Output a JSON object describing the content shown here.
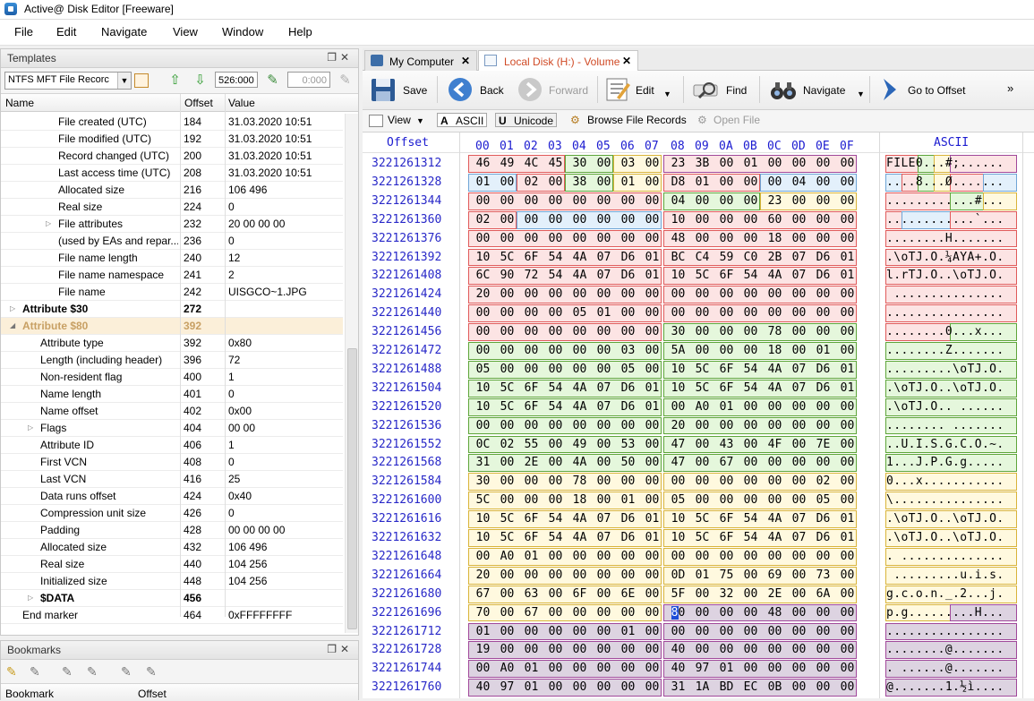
{
  "window": {
    "title": "Active@ Disk Editor [Freeware]"
  },
  "menu": [
    "File",
    "Edit",
    "Navigate",
    "View",
    "Window",
    "Help"
  ],
  "templates_panel": {
    "title": "Templates",
    "template_select": "NTFS MFT File Recorc",
    "offset_value": "526:000",
    "secondary_value": "0:000",
    "columns": {
      "name": "Name",
      "offset": "Offset",
      "value": "Value"
    },
    "rows": [
      {
        "name": "File created (UTC)",
        "offset": "184",
        "value": "31.03.2020 10:51",
        "indent": 3
      },
      {
        "name": "File modified (UTC)",
        "offset": "192",
        "value": "31.03.2020 10:51",
        "indent": 3
      },
      {
        "name": "Record changed (UTC)",
        "offset": "200",
        "value": "31.03.2020 10:51",
        "indent": 3
      },
      {
        "name": "Last access time (UTC)",
        "offset": "208",
        "value": "31.03.2020 10:51",
        "indent": 3
      },
      {
        "name": "Allocated size",
        "offset": "216",
        "value": "106 496",
        "indent": 3
      },
      {
        "name": "Real size",
        "offset": "224",
        "value": "0",
        "indent": 3
      },
      {
        "name": "File attributes",
        "offset": "232",
        "value": "20 00 00 00",
        "indent": 3,
        "expander": "collapsed"
      },
      {
        "name": "(used by EAs and repar...",
        "offset": "236",
        "value": "0",
        "indent": 3
      },
      {
        "name": "File name length",
        "offset": "240",
        "value": "12",
        "indent": 3
      },
      {
        "name": "File name namespace",
        "offset": "241",
        "value": "2",
        "indent": 3
      },
      {
        "name": "File name",
        "offset": "242",
        "value": "UISGCO~1.JPG",
        "indent": 3
      },
      {
        "name": "Attribute $30",
        "offset": "272",
        "value": "",
        "indent": 1,
        "bold": true,
        "expander": "collapsed"
      },
      {
        "name": "Attribute $80",
        "offset": "392",
        "value": "",
        "indent": 1,
        "bold": true,
        "selected": true,
        "expander": "expanded"
      },
      {
        "name": "Attribute type",
        "offset": "392",
        "value": "0x80",
        "indent": 2
      },
      {
        "name": "Length (including header)",
        "offset": "396",
        "value": "72",
        "indent": 2
      },
      {
        "name": "Non-resident flag",
        "offset": "400",
        "value": "1",
        "indent": 2
      },
      {
        "name": "Name length",
        "offset": "401",
        "value": "0",
        "indent": 2
      },
      {
        "name": "Name offset",
        "offset": "402",
        "value": "0x00",
        "indent": 2
      },
      {
        "name": "Flags",
        "offset": "404",
        "value": "00 00",
        "indent": 2,
        "expander": "collapsed"
      },
      {
        "name": "Attribute ID",
        "offset": "406",
        "value": "1",
        "indent": 2
      },
      {
        "name": "First VCN",
        "offset": "408",
        "value": "0",
        "indent": 2
      },
      {
        "name": "Last VCN",
        "offset": "416",
        "value": "25",
        "indent": 2
      },
      {
        "name": "Data runs offset",
        "offset": "424",
        "value": "0x40",
        "indent": 2
      },
      {
        "name": "Compression unit size",
        "offset": "426",
        "value": "0",
        "indent": 2
      },
      {
        "name": "Padding",
        "offset": "428",
        "value": "00 00 00 00",
        "indent": 2
      },
      {
        "name": "Allocated size",
        "offset": "432",
        "value": "106 496",
        "indent": 2
      },
      {
        "name": "Real size",
        "offset": "440",
        "value": "104 256",
        "indent": 2
      },
      {
        "name": "Initialized size",
        "offset": "448",
        "value": "104 256",
        "indent": 2
      },
      {
        "name": "$DATA",
        "offset": "456",
        "value": "",
        "indent": 2,
        "bold": true,
        "expander": "collapsed"
      },
      {
        "name": "End marker",
        "offset": "464",
        "value": "0xFFFFFFFF",
        "indent": 1
      }
    ]
  },
  "bookmarks_panel": {
    "title": "Bookmarks",
    "columns": {
      "bookmark": "Bookmark",
      "offset": "Offset"
    }
  },
  "tabs": [
    {
      "label": "My Computer",
      "active": false
    },
    {
      "label": "Local Disk (H:) - Volume",
      "active": true
    }
  ],
  "toolbar": {
    "save": "Save",
    "back": "Back",
    "forward": "Forward",
    "edit": "Edit",
    "find": "Find",
    "navigate": "Navigate",
    "goto": "Go to Offset",
    "more": "»"
  },
  "subtoolbar": {
    "view": "View",
    "ascii": "ASCII",
    "unicode": "Unicode",
    "browse": "Browse File Records",
    "open_file": "Open File"
  },
  "hex": {
    "offset_header": "Offset",
    "ascii_header": "ASCII",
    "byte_headers": [
      "00",
      "01",
      "02",
      "03",
      "04",
      "05",
      "06",
      "07",
      "08",
      "09",
      "0A",
      "0B",
      "0C",
      "0D",
      "0E",
      "0F"
    ],
    "cursor_digit": "8",
    "cursor_rest": "0",
    "rows": [
      {
        "offset": "3221261312",
        "bytes": [
          "46",
          "49",
          "4C",
          "45",
          "30",
          "00",
          "03",
          "00",
          "23",
          "3B",
          "00",
          "01",
          "00",
          "00",
          "00",
          "00"
        ],
        "ascii": "FILE0...#;......"
      },
      {
        "offset": "3221261328",
        "bytes": [
          "01",
          "00",
          "02",
          "00",
          "38",
          "00",
          "01",
          "00",
          "D8",
          "01",
          "00",
          "00",
          "00",
          "04",
          "00",
          "00"
        ],
        "ascii": "....8...Ø......."
      },
      {
        "offset": "3221261344",
        "bytes": [
          "00",
          "00",
          "00",
          "00",
          "00",
          "00",
          "00",
          "00",
          "04",
          "00",
          "00",
          "00",
          "23",
          "00",
          "00",
          "00"
        ],
        "ascii": "............#..."
      },
      {
        "offset": "3221261360",
        "bytes": [
          "02",
          "00",
          "00",
          "00",
          "00",
          "00",
          "00",
          "00",
          "10",
          "00",
          "00",
          "00",
          "60",
          "00",
          "00",
          "00"
        ],
        "ascii": "............`..."
      },
      {
        "offset": "3221261376",
        "bytes": [
          "00",
          "00",
          "00",
          "00",
          "00",
          "00",
          "00",
          "00",
          "48",
          "00",
          "00",
          "00",
          "18",
          "00",
          "00",
          "00"
        ],
        "ascii": "........H......."
      },
      {
        "offset": "3221261392",
        "bytes": [
          "10",
          "5C",
          "6F",
          "54",
          "4A",
          "07",
          "D6",
          "01",
          "BC",
          "C4",
          "59",
          "C0",
          "2B",
          "07",
          "D6",
          "01"
        ],
        "ascii": ".\\oTJ.Ö.¼ÄYÀ+.Ö."
      },
      {
        "offset": "3221261408",
        "bytes": [
          "6C",
          "90",
          "72",
          "54",
          "4A",
          "07",
          "D6",
          "01",
          "10",
          "5C",
          "6F",
          "54",
          "4A",
          "07",
          "D6",
          "01"
        ],
        "ascii": "l.rTJ.Ö..\\oTJ.Ö."
      },
      {
        "offset": "3221261424",
        "bytes": [
          "20",
          "00",
          "00",
          "00",
          "00",
          "00",
          "00",
          "00",
          "00",
          "00",
          "00",
          "00",
          "00",
          "00",
          "00",
          "00"
        ],
        "ascii": " ..............."
      },
      {
        "offset": "3221261440",
        "bytes": [
          "00",
          "00",
          "00",
          "00",
          "05",
          "01",
          "00",
          "00",
          "00",
          "00",
          "00",
          "00",
          "00",
          "00",
          "00",
          "00"
        ],
        "ascii": "................"
      },
      {
        "offset": "3221261456",
        "bytes": [
          "00",
          "00",
          "00",
          "00",
          "00",
          "00",
          "00",
          "00",
          "30",
          "00",
          "00",
          "00",
          "78",
          "00",
          "00",
          "00"
        ],
        "ascii": "........0...x..."
      },
      {
        "offset": "3221261472",
        "bytes": [
          "00",
          "00",
          "00",
          "00",
          "00",
          "00",
          "03",
          "00",
          "5A",
          "00",
          "00",
          "00",
          "18",
          "00",
          "01",
          "00"
        ],
        "ascii": "........Z......."
      },
      {
        "offset": "3221261488",
        "bytes": [
          "05",
          "00",
          "00",
          "00",
          "00",
          "00",
          "05",
          "00",
          "10",
          "5C",
          "6F",
          "54",
          "4A",
          "07",
          "D6",
          "01"
        ],
        "ascii": ".........\\oTJ.Ö."
      },
      {
        "offset": "3221261504",
        "bytes": [
          "10",
          "5C",
          "6F",
          "54",
          "4A",
          "07",
          "D6",
          "01",
          "10",
          "5C",
          "6F",
          "54",
          "4A",
          "07",
          "D6",
          "01"
        ],
        "ascii": ".\\oTJ.Ö..\\oTJ.Ö."
      },
      {
        "offset": "3221261520",
        "bytes": [
          "10",
          "5C",
          "6F",
          "54",
          "4A",
          "07",
          "D6",
          "01",
          "00",
          "A0",
          "01",
          "00",
          "00",
          "00",
          "00",
          "00"
        ],
        "ascii": ".\\oTJ.Ö.. ......"
      },
      {
        "offset": "3221261536",
        "bytes": [
          "00",
          "00",
          "00",
          "00",
          "00",
          "00",
          "00",
          "00",
          "20",
          "00",
          "00",
          "00",
          "00",
          "00",
          "00",
          "00"
        ],
        "ascii": "........ ......."
      },
      {
        "offset": "3221261552",
        "bytes": [
          "0C",
          "02",
          "55",
          "00",
          "49",
          "00",
          "53",
          "00",
          "47",
          "00",
          "43",
          "00",
          "4F",
          "00",
          "7E",
          "00"
        ],
        "ascii": "..U.I.S.G.C.O.~."
      },
      {
        "offset": "3221261568",
        "bytes": [
          "31",
          "00",
          "2E",
          "00",
          "4A",
          "00",
          "50",
          "00",
          "47",
          "00",
          "67",
          "00",
          "00",
          "00",
          "00",
          "00"
        ],
        "ascii": "1...J.P.G.g....."
      },
      {
        "offset": "3221261584",
        "bytes": [
          "30",
          "00",
          "00",
          "00",
          "78",
          "00",
          "00",
          "00",
          "00",
          "00",
          "00",
          "00",
          "00",
          "00",
          "02",
          "00"
        ],
        "ascii": "0...x..........."
      },
      {
        "offset": "3221261600",
        "bytes": [
          "5C",
          "00",
          "00",
          "00",
          "18",
          "00",
          "01",
          "00",
          "05",
          "00",
          "00",
          "00",
          "00",
          "00",
          "05",
          "00"
        ],
        "ascii": "\\..............."
      },
      {
        "offset": "3221261616",
        "bytes": [
          "10",
          "5C",
          "6F",
          "54",
          "4A",
          "07",
          "D6",
          "01",
          "10",
          "5C",
          "6F",
          "54",
          "4A",
          "07",
          "D6",
          "01"
        ],
        "ascii": ".\\oTJ.Ö..\\oTJ.Ö."
      },
      {
        "offset": "3221261632",
        "bytes": [
          "10",
          "5C",
          "6F",
          "54",
          "4A",
          "07",
          "D6",
          "01",
          "10",
          "5C",
          "6F",
          "54",
          "4A",
          "07",
          "D6",
          "01"
        ],
        "ascii": ".\\oTJ.Ö..\\oTJ.Ö."
      },
      {
        "offset": "3221261648",
        "bytes": [
          "00",
          "A0",
          "01",
          "00",
          "00",
          "00",
          "00",
          "00",
          "00",
          "00",
          "00",
          "00",
          "00",
          "00",
          "00",
          "00"
        ],
        "ascii": ". .............."
      },
      {
        "offset": "3221261664",
        "bytes": [
          "20",
          "00",
          "00",
          "00",
          "00",
          "00",
          "00",
          "00",
          "0D",
          "01",
          "75",
          "00",
          "69",
          "00",
          "73",
          "00"
        ],
        "ascii": " .........u.i.s."
      },
      {
        "offset": "3221261680",
        "bytes": [
          "67",
          "00",
          "63",
          "00",
          "6F",
          "00",
          "6E",
          "00",
          "5F",
          "00",
          "32",
          "00",
          "2E",
          "00",
          "6A",
          "00"
        ],
        "ascii": "g.c.o.n._.2...j."
      },
      {
        "offset": "3221261696",
        "bytes": [
          "70",
          "00",
          "67",
          "00",
          "00",
          "00",
          "00",
          "00",
          "80",
          "00",
          "00",
          "00",
          "48",
          "00",
          "00",
          "00"
        ],
        "ascii": "p.g.........H..."
      },
      {
        "offset": "3221261712",
        "bytes": [
          "01",
          "00",
          "00",
          "00",
          "00",
          "00",
          "01",
          "00",
          "00",
          "00",
          "00",
          "00",
          "00",
          "00",
          "00",
          "00"
        ],
        "ascii": "................"
      },
      {
        "offset": "3221261728",
        "bytes": [
          "19",
          "00",
          "00",
          "00",
          "00",
          "00",
          "00",
          "00",
          "40",
          "00",
          "00",
          "00",
          "00",
          "00",
          "00",
          "00"
        ],
        "ascii": "........@......."
      },
      {
        "offset": "3221261744",
        "bytes": [
          "00",
          "A0",
          "01",
          "00",
          "00",
          "00",
          "00",
          "00",
          "40",
          "97",
          "01",
          "00",
          "00",
          "00",
          "00",
          "00"
        ],
        "ascii": ". ......@......."
      },
      {
        "offset": "3221261760",
        "bytes": [
          "40",
          "97",
          "01",
          "00",
          "00",
          "00",
          "00",
          "00",
          "31",
          "1A",
          "BD",
          "EC",
          "0B",
          "00",
          "00",
          "00"
        ],
        "ascii": "@.......1.½ì...."
      }
    ]
  },
  "colors": {
    "header_region_bg": "#fce4e4",
    "header_region_border": "#e05a5a",
    "attr30_bg": "#e5f7dc",
    "attr30_border": "#5ea53a",
    "attr30b_bg": "#fff9df",
    "attr30b_border": "#d9b43a",
    "attr80_bg": "#ddd3e1",
    "attr80_border": "#a0489a",
    "offset_text": "#2828c8",
    "selection": "#1c4cd8"
  }
}
